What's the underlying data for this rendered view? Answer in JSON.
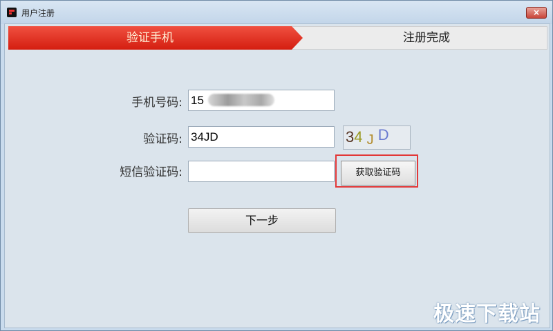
{
  "window": {
    "title": "用户注册",
    "close_glyph": "×"
  },
  "steps": [
    "验证手机",
    "注册完成"
  ],
  "form": {
    "phone_label": "手机号码:",
    "phone_value": "15",
    "code_label": "验证码:",
    "code_value": "34JD",
    "captcha_chars": [
      "3",
      "4",
      "J",
      "D"
    ],
    "sms_label": "短信验证码:",
    "sms_value": "",
    "get_code_button": "获取验证码",
    "next_button": "下一步"
  },
  "watermark": "极速下载站",
  "colors": {
    "active_step": "#e2331f",
    "highlight": "#e23838",
    "window_bg": "#dbe4ec"
  }
}
